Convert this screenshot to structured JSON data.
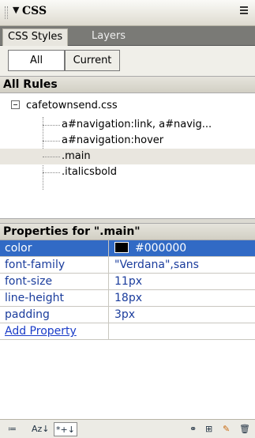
{
  "panel": {
    "title": "CSS"
  },
  "tabs": [
    {
      "label": "CSS Styles",
      "active": true
    },
    {
      "label": "Layers",
      "active": false
    }
  ],
  "toggles": {
    "all_label": "All",
    "current_label": "Current"
  },
  "rules": {
    "header": "All Rules",
    "file": "cafetownsend.css",
    "items": [
      {
        "label": "a#navigation:link, a#navig..."
      },
      {
        "label": "a#navigation:hover"
      },
      {
        "label": ".main",
        "selected": true
      },
      {
        "label": ".italicsbold"
      }
    ]
  },
  "properties": {
    "header": "Properties for \".main\"",
    "rows": [
      {
        "name": "color",
        "value": "#000000",
        "swatch": "#000000",
        "selected": true
      },
      {
        "name": "font-family",
        "value": "\"Verdana\",sans"
      },
      {
        "name": "font-size",
        "value": "11px"
      },
      {
        "name": "line-height",
        "value": "18px"
      },
      {
        "name": "padding",
        "value": "3px"
      }
    ],
    "add_label": "Add Property"
  },
  "toolbar": {
    "category_view": "≔",
    "alpha_view": "Az↓",
    "set_props_view": "*+↓",
    "attach": "⚭",
    "new_rule": "⊞",
    "edit": "✎",
    "delete": "🗑"
  },
  "colors": {
    "selection": "#316ac5",
    "prop_text": "#1a3c9c"
  }
}
